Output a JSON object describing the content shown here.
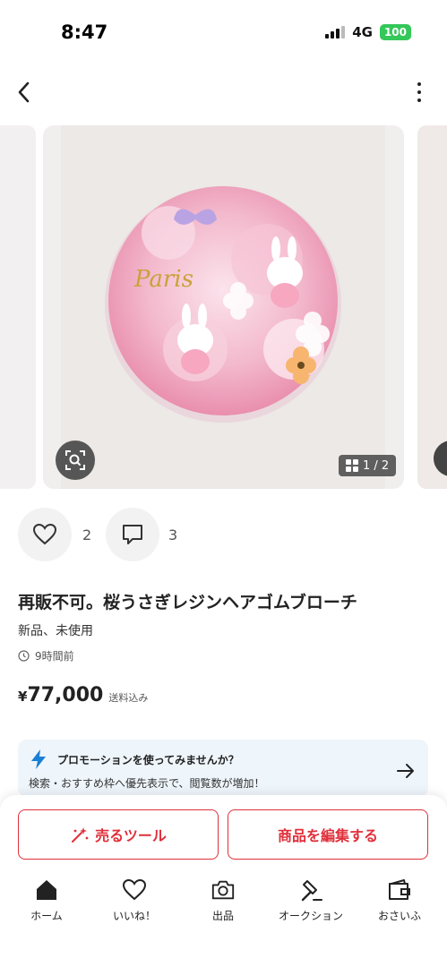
{
  "status_bar": {
    "time": "8:47",
    "network": "4G",
    "battery": "100"
  },
  "images": {
    "counter": "1 / 2"
  },
  "engagement": {
    "likes": "2",
    "comments": "3"
  },
  "item": {
    "title": "再販不可。桜うさぎレジンヘアゴムブローチ",
    "condition": "新品、未使用",
    "posted_time": "9時間前",
    "price_currency": "¥",
    "price": "77,000",
    "shipping": "送料込み"
  },
  "promo": {
    "title": "プロモーションを使ってみませんか？",
    "subtitle": "検索・おすすめ枠へ優先表示で、閲覧数が増加！"
  },
  "actions": {
    "sell_tool": "売るツール",
    "edit_item": "商品を編集する"
  },
  "tabbar": {
    "items": [
      {
        "label": "ホーム",
        "icon": "home-icon"
      },
      {
        "label": "いいね！",
        "icon": "heart-icon"
      },
      {
        "label": "出品",
        "icon": "camera-icon"
      },
      {
        "label": "オークション",
        "icon": "gavel-icon"
      },
      {
        "label": "おさいふ",
        "icon": "wallet-icon"
      }
    ]
  },
  "colors": {
    "accent": "#e02f3a",
    "promo_bg": "#eef5fb",
    "bolt": "#1a7fd6"
  }
}
